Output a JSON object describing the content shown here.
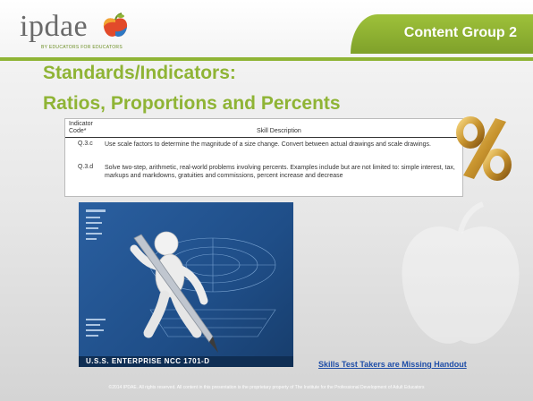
{
  "header": {
    "logo_text": "ipdae",
    "logo_subtext": "BY EDUCATORS FOR EDUCATORS",
    "content_group": "Content Group 2"
  },
  "title": {
    "line1": "Standards/Indicators:",
    "line2": "Ratios, Proportions and Percents"
  },
  "table": {
    "header_left": "Indicator\nCode*",
    "header_right": "Skill Description",
    "rows": [
      {
        "code": "Q.3.c",
        "description": "Use scale factors to determine the magnitude of a size change. Convert between actual drawings and scale drawings."
      },
      {
        "code": "Q.3.d",
        "description": "Solve two-step, arithmetic, real-world problems involving percents. Examples include but are not limited to: simple interest, tax, markups and markdowns, gratuities and commissions, percent increase and decrease"
      }
    ]
  },
  "image_caption": "U.S.S. ENTERPRISE NCC 1701-D",
  "handout_link": "Skills Test Takers are Missing  Handout",
  "footer": "©2014 IPDAE. All rights reserved. All content in this presentation is the proprietary property of The Institute for the Professional Development of Adult Educators",
  "colors": {
    "accent_green": "#8fb435",
    "link_blue": "#1f4ea8",
    "blueprint_blue": "#2a5fa0"
  }
}
